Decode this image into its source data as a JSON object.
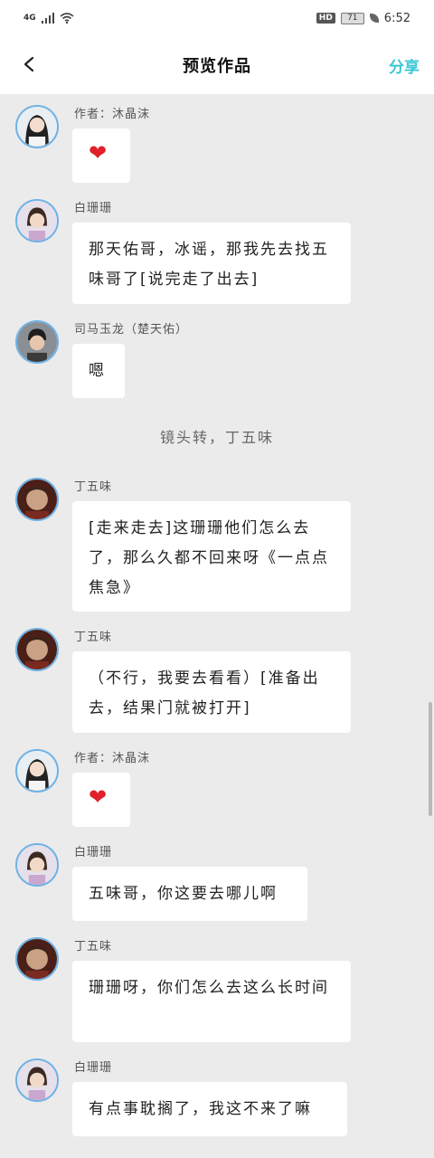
{
  "status": {
    "signal": "4G",
    "hd": "HD",
    "battery": "71",
    "time": "6:52"
  },
  "nav": {
    "title": "预览作品",
    "share": "分享"
  },
  "messages": [
    {
      "name": "作者：沐晶沫",
      "text": "❤",
      "avatar": "author"
    },
    {
      "name": "白珊珊",
      "text": "那天佑哥，冰谣，那我先去找五味哥了[说完走了出去]",
      "avatar": "bai"
    },
    {
      "name": "司马玉龙（楚天佑）",
      "text": "嗯",
      "avatar": "sima"
    },
    {
      "narration": "镜头转，丁五味"
    },
    {
      "name": "丁五味",
      "text": "[走来走去]这珊珊他们怎么去了，那么久都不回来呀《一点点焦急》",
      "avatar": "ding"
    },
    {
      "name": "丁五味",
      "text": "（不行，我要去看看）[准备出去，结果门就被打开]",
      "avatar": "ding"
    },
    {
      "name": "作者：沐晶沫",
      "text": "❤",
      "avatar": "author"
    },
    {
      "name": "白珊珊",
      "text": "五味哥，你这要去哪儿啊",
      "avatar": "bai"
    },
    {
      "name": "丁五味",
      "text": "珊珊呀，你们怎么去这么长时间",
      "avatar": "ding"
    },
    {
      "name": "白珊珊",
      "text": "有点事耽搁了，我这不来了嘛",
      "avatar": "bai"
    }
  ],
  "colors": {
    "accent": "#3cc7d6",
    "heart": "#e0202a",
    "avatar_ring": "#6fb2e6"
  }
}
